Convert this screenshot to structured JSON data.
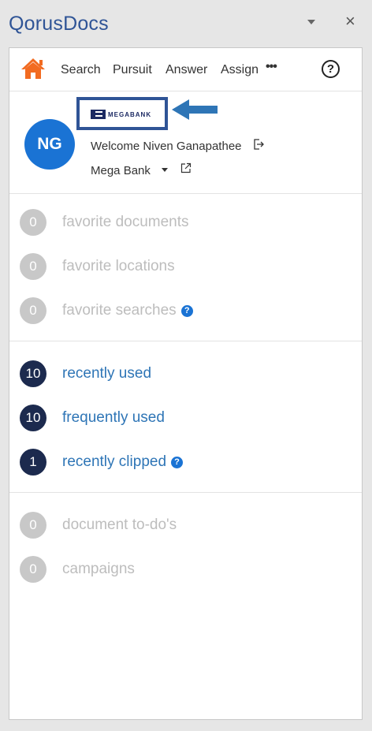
{
  "pane": {
    "title": "QorusDocs",
    "close_glyph": "×"
  },
  "nav": {
    "items": [
      {
        "label": "Search"
      },
      {
        "label": "Pursuit"
      },
      {
        "label": "Answer"
      },
      {
        "label": "Assign"
      }
    ],
    "more_glyph": "•••",
    "help_glyph": "?",
    "home_color": "#f26b21"
  },
  "profile": {
    "initials": "NG",
    "welcome": "Welcome Niven Ganapathee",
    "org": "Mega Bank",
    "logo_text": "MEGABANK",
    "avatar_color": "#1a73d4",
    "highlight_color": "#2f5496"
  },
  "favorites": [
    {
      "count": "0",
      "label": "favorite documents",
      "info": false
    },
    {
      "count": "0",
      "label": "favorite locations",
      "info": false
    },
    {
      "count": "0",
      "label": "favorite searches",
      "info": true
    }
  ],
  "recent": [
    {
      "count": "10",
      "label": "recently used",
      "info": false
    },
    {
      "count": "10",
      "label": "frequently used",
      "info": false
    },
    {
      "count": "1",
      "label": "recently clipped",
      "info": true
    }
  ],
  "tasks": [
    {
      "count": "0",
      "label": "document to-do's"
    },
    {
      "count": "0",
      "label": "campaigns"
    }
  ],
  "info_glyph": "?",
  "colors": {
    "inactive_badge": "#c8c8c8",
    "active_badge": "#1c2a4e",
    "active_text": "#2e75b6",
    "inactive_text": "#bdbdbd"
  }
}
